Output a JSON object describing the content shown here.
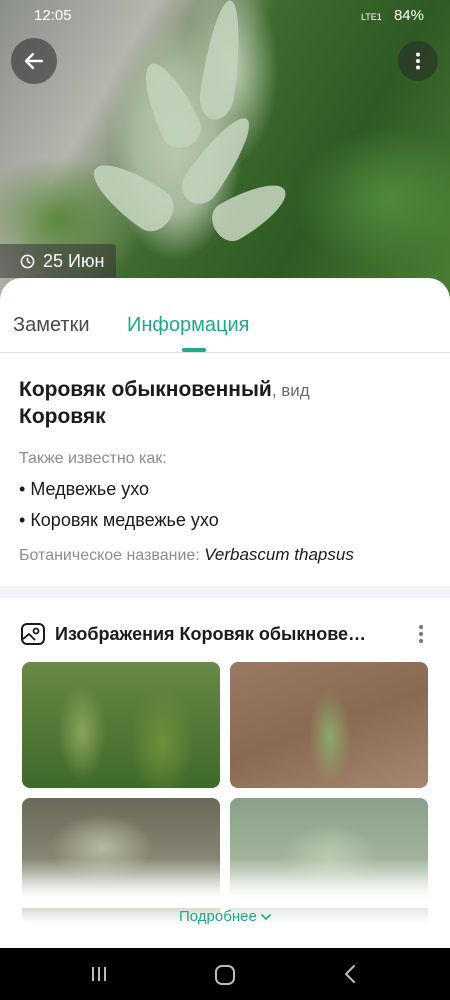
{
  "status_bar": {
    "time": "12:05",
    "battery": "84%",
    "network": "LTE1"
  },
  "hero": {
    "date": "25 Июн"
  },
  "tabs": [
    {
      "label": "Заметки"
    },
    {
      "label": "Информация",
      "active": true
    }
  ],
  "info": {
    "common_name": "Коровяк обыкновенный",
    "rank": ", вид",
    "genus": "Коровяк",
    "aka_label": "Также известно как:",
    "aka": [
      "Медвежье ухо",
      "Коровяк медвежье ухо"
    ],
    "botanical_label": "Ботаническое название: ",
    "botanical_name": "Verbascum thapsus"
  },
  "images_card": {
    "title": "Изображения Коровяк обыкнове…",
    "more_label": "Подробнее"
  },
  "colors": {
    "accent": "#1fa98a",
    "text": "#1b1b1b",
    "muted": "#8d8d8d"
  },
  "icons": [
    "back-arrow-icon",
    "more-vert-icon",
    "clock-icon",
    "gallery-icon",
    "chevron-down-icon",
    "recents-icon",
    "home-icon",
    "back-nav-icon"
  ]
}
